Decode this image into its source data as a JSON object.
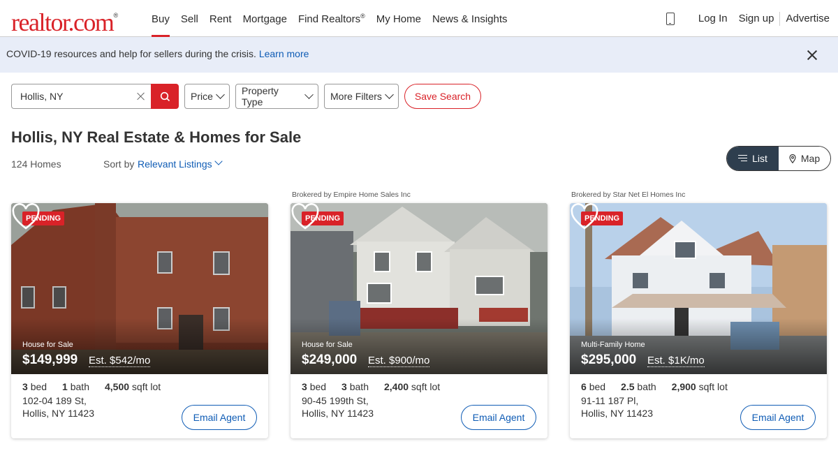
{
  "header": {
    "logo": "realtor.com",
    "logo_mark": "®",
    "nav": [
      "Buy",
      "Sell",
      "Rent",
      "Mortgage",
      "Find Realtors",
      "My Home",
      "News & Insights"
    ],
    "nav_active": "Buy",
    "find_realtors_mark": "®",
    "login": "Log In",
    "signup": "Sign up",
    "advertise": "Advertise"
  },
  "banner": {
    "text": "COVID-19 resources and help for sellers during the crisis.",
    "link": "Learn more"
  },
  "search": {
    "value": "Hollis, NY",
    "filters": [
      "Price",
      "Property Type",
      "More Filters"
    ],
    "save_search": "Save Search"
  },
  "results": {
    "title": "Hollis, NY Real Estate & Homes for Sale",
    "count": "124 Homes",
    "sort_label": "Sort by",
    "sort_value": "Relevant Listings",
    "view_list": "List",
    "view_map": "Map"
  },
  "listings": [
    {
      "brokered": "",
      "status": "PENDING",
      "type": "House for Sale",
      "price": "$149,999",
      "estimate": "Est. $542/mo",
      "beds": "3",
      "beds_label": "bed",
      "baths": "1",
      "baths_label": "bath",
      "size": "4,500",
      "size_label": "sqft lot",
      "street": "102-04 189 St,",
      "city": "Hollis, NY 11423",
      "cta": "Email Agent"
    },
    {
      "brokered": "Brokered by Empire Home Sales Inc",
      "status": "PENDING",
      "type": "House for Sale",
      "price": "$249,000",
      "estimate": "Est. $900/mo",
      "beds": "3",
      "beds_label": "bed",
      "baths": "3",
      "baths_label": "bath",
      "size": "2,400",
      "size_label": "sqft lot",
      "street": "90-45 199th St,",
      "city": "Hollis, NY 11423",
      "cta": "Email Agent"
    },
    {
      "brokered": "Brokered by Star Net El Homes Inc",
      "status": "PENDING",
      "type": "Multi-Family Home",
      "price": "$295,000",
      "estimate": "Est. $1K/mo",
      "beds": "6",
      "beds_label": "bed",
      "baths": "2.5",
      "baths_label": "bath",
      "size": "2,900",
      "size_label": "sqft lot",
      "street": "91-11 187 Pl,",
      "city": "Hollis, NY 11423",
      "cta": "Email Agent"
    }
  ],
  "colors": {
    "brand_red": "#d92228",
    "link_blue": "#0f5cb5",
    "banner_bg": "#e8edf8",
    "toggle_active": "#2e3e4e"
  },
  "icons": {
    "phone": "phone-icon",
    "close": "close-icon",
    "clear": "clear-icon",
    "search": "search-icon",
    "list": "list-icon",
    "map_pin": "map-pin-icon",
    "heart": "heart-icon"
  }
}
